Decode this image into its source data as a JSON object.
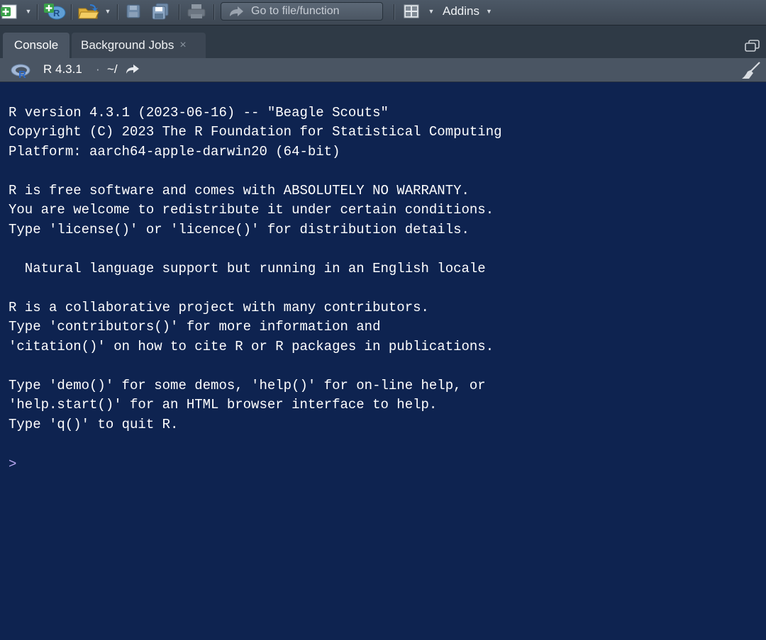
{
  "toolbar": {
    "goto_placeholder": "Go to file/function",
    "addins_label": "Addins",
    "icons": [
      "new-file-icon",
      "new-project-icon",
      "open-file-icon",
      "save-icon",
      "save-all-icon",
      "print-icon",
      "grid-layout-icon"
    ]
  },
  "tabs": [
    {
      "label": "Console",
      "active": true
    },
    {
      "label": "Background Jobs",
      "active": false,
      "close": "×"
    }
  ],
  "pathbar": {
    "r_version": "R 4.3.1",
    "separator": "·",
    "working_dir": "~/"
  },
  "console": {
    "lines": [
      "R version 4.3.1 (2023-06-16) -- \"Beagle Scouts\"",
      "Copyright (C) 2023 The R Foundation for Statistical Computing",
      "Platform: aarch64-apple-darwin20 (64-bit)",
      "",
      "R is free software and comes with ABSOLUTELY NO WARRANTY.",
      "You are welcome to redistribute it under certain conditions.",
      "Type 'license()' or 'licence()' for distribution details.",
      "",
      "  Natural language support but running in an English locale",
      "",
      "R is a collaborative project with many contributors.",
      "Type 'contributors()' for more information and",
      "'citation()' on how to cite R or R packages in publications.",
      "",
      "Type 'demo()' for some demos, 'help()' for on-line help, or",
      "'help.start()' for an HTML browser interface to help.",
      "Type 'q()' to quit R."
    ],
    "prompt": ">"
  },
  "colors": {
    "console_bg": "#0e2350",
    "console_text": "#ffffff",
    "prompt": "#b9a8f2"
  }
}
